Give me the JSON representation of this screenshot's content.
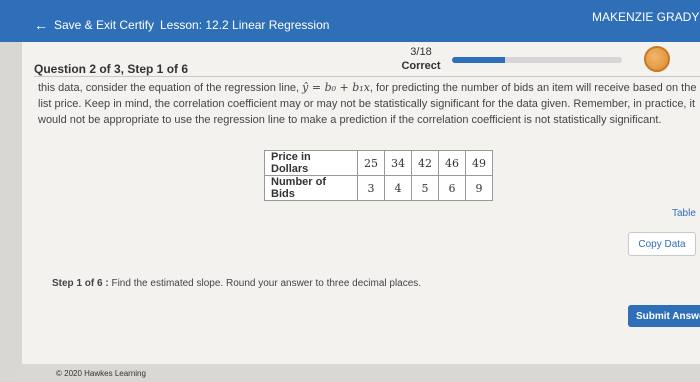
{
  "header": {
    "back_label": "Save & Exit Certify",
    "lesson": "Lesson: 12.2 Linear Regression",
    "user_name": "MAKENZIE GRADY"
  },
  "question": {
    "title": "Question 2 of 3, Step 1 of 6",
    "score": "3/18",
    "status": "Correct",
    "progress_fraction": 0.31,
    "prompt_before": "this data, consider the equation of the regression line, ",
    "equation": "ŷ = b₀ + b₁x",
    "prompt_after": ", for predicting the number of bids an item will receive based on the list price. Keep in mind, the correlation coefficient may or may not be statistically significant for the data given. Remember, in practice, it would not be appropriate to use the regression line to make a prediction if the correlation coefficient is not statistically significant."
  },
  "table": {
    "rows": [
      {
        "label": "Price in Dollars",
        "values": [
          "25",
          "34",
          "42",
          "46",
          "49"
        ]
      },
      {
        "label": "Number of Bids",
        "values": [
          "3",
          "4",
          "5",
          "6",
          "9"
        ]
      }
    ]
  },
  "actions": {
    "table_link": "Table",
    "copy_data": "Copy Data",
    "submit": "Submit Answe"
  },
  "step": {
    "label": "Step 1 of 6 :",
    "text": "Find the estimated slope. Round your answer to three decimal places."
  },
  "footer": {
    "copyright": "© 2020 Hawkes Learning"
  },
  "colors": {
    "brand_blue": "#2f6fb8",
    "badge_orange": "#d98a2e"
  }
}
